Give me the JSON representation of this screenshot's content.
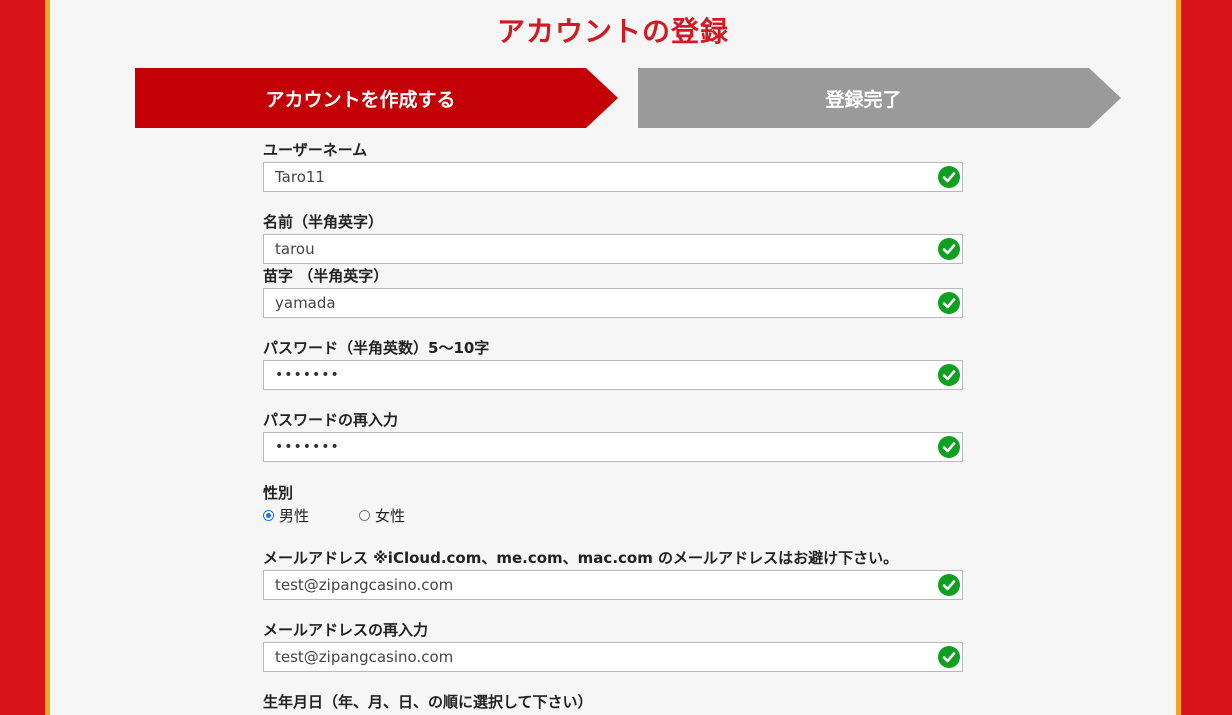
{
  "page": {
    "title": "アカウントの登録"
  },
  "steps": [
    {
      "label": "アカウントを作成する",
      "active": true
    },
    {
      "label": "登録完了",
      "active": false
    }
  ],
  "form": {
    "username": {
      "label": "ユーザーネーム",
      "value": "Taro11"
    },
    "first_name": {
      "label": "名前（半角英字）",
      "value": "tarou"
    },
    "last_name": {
      "label": "苗字 （半角英字）",
      "value": "yamada"
    },
    "password": {
      "label": "パスワード（半角英数）5〜10字",
      "value": "•••••••"
    },
    "password_confirm": {
      "label": "パスワードの再入力",
      "value": "•••••••"
    },
    "gender": {
      "label": "性別",
      "options": [
        {
          "label": "男性",
          "checked": true
        },
        {
          "label": "女性",
          "checked": false
        }
      ]
    },
    "email": {
      "label": "メールアドレス ※iCloud.com、me.com、mac.com のメールアドレスはお避け下さい。",
      "value": "test@zipangcasino.com"
    },
    "email_confirm": {
      "label": "メールアドレスの再入力",
      "value": "test@zipangcasino.com"
    },
    "birthdate": {
      "label": "生年月日（年、月、日、の順に選択して下さい）"
    }
  },
  "colors": {
    "brand_red": "#d11a21",
    "active_step": "#c20006",
    "inactive_step": "#9a9a9a",
    "valid_check": "#0ea020",
    "frame_red": "#d8141a",
    "frame_gold": "#f3a51f"
  },
  "icons": {
    "valid": "check-circle-icon"
  }
}
